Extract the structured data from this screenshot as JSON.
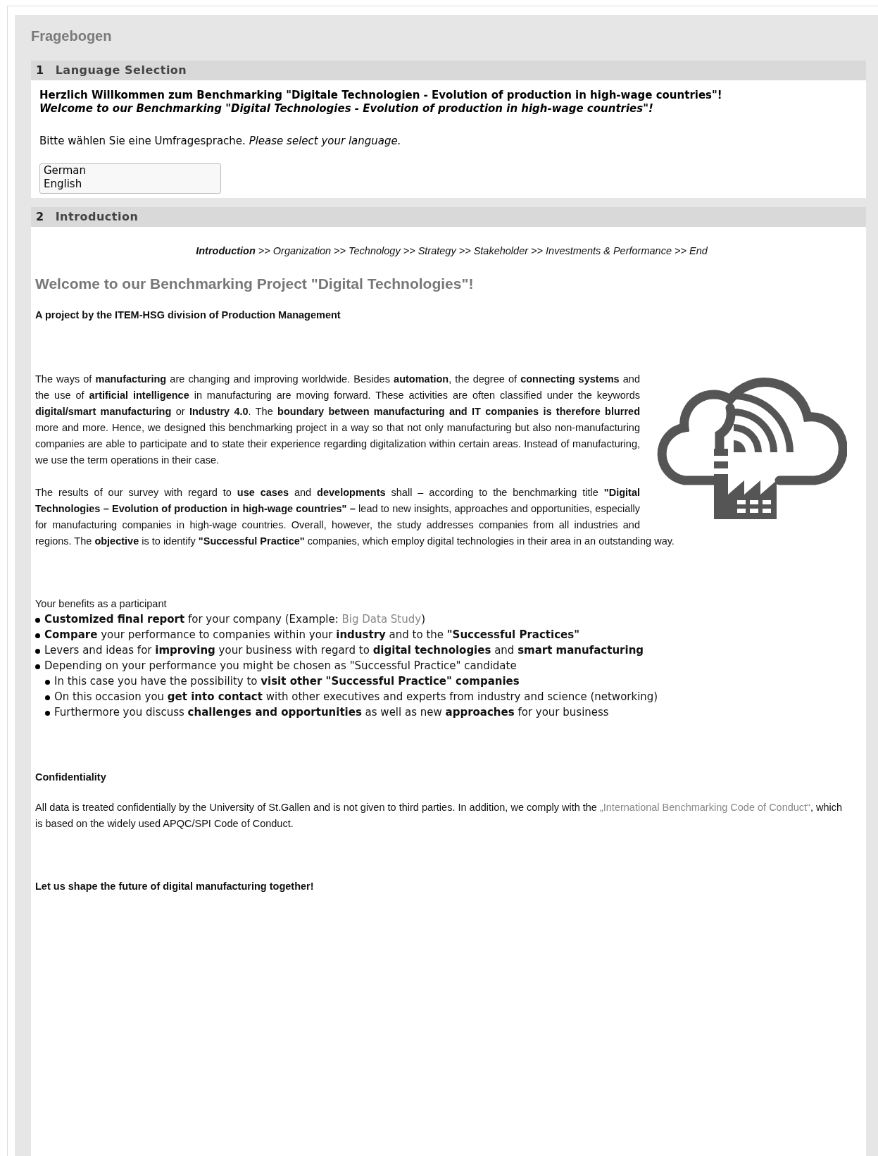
{
  "page_title": "Fragebogen",
  "sections": [
    {
      "number": "1",
      "title": "Language Selection"
    },
    {
      "number": "2",
      "title": "Introduction"
    }
  ],
  "language": {
    "welcome_de": "Herzlich Willkommen zum Benchmarking \"Digitale Technologien - Evolution of production in high-wage countries\"!",
    "welcome_en": "Welcome to our Benchmarking \"Digital Technologies - Evolution of production in high-wage countries\"!",
    "prompt": "Bitte wählen Sie eine Umfragesprache. *Please select your language.*",
    "options": [
      {
        "label": "German",
        "selected": false
      },
      {
        "label": "English",
        "selected": false
      }
    ]
  },
  "intro": {
    "breadcrumb": [
      {
        "label": "Introduction",
        "selected": true
      },
      {
        "label": "Organization",
        "selected": false
      },
      {
        "label": "Technology",
        "selected": false
      },
      {
        "label": "Strategy",
        "selected": false
      },
      {
        "label": "Stakeholder",
        "selected": false
      },
      {
        "label": "Investments & Performance",
        "selected": false
      },
      {
        "label": "End",
        "selected": false
      }
    ],
    "separator": ">>",
    "heading": "Welcome to our Benchmarking Project \"Digital Technologies\"!",
    "byline": "A project by the ITEM-HSG division of Production Management",
    "paragraphs": [
      "The ways of **manufacturing** are changing and improving worldwide. Besides **automation**, the degree of **connecting systems** and the use of **artificial intelligence** in manufacturing are moving forward. These activities are often classified under the keywords **digital/smart manufacturing** or **Industry 4.0**. The **boundary between manufacturing and IT companies is therefore blurred** more and more. Hence, we designed this benchmarking project in a way so that not only manufacturing but also non-manufacturing companies are able to participate and to state their experience regarding digitalization within certain areas. Instead of manufacturing, we use the term operations in their case.",
      "The results of our survey with regard to **use cases** and **developments** shall – according to the benchmarking title **\"Digital Technologies – Evolution of production in high-wage countries\" –** lead to new insights, approaches and opportunities, especially for manufacturing companies in high-wage countries. Overall, however, the study addresses companies from all industries and regions. The **objective** is to identify **\"Successful Practice\"** companies, which employ digital technologies in their area in an outstanding way."
    ],
    "benefits_title": "Your benefits as a participant",
    "benefits": [
      {
        "text": "**Customized final report** for your company (Example: ",
        "link": "Big Data Study",
        "after": ")"
      },
      {
        "text": "**Compare** your performance to companies within your **industry** and to the **\"Successful Practices\"**"
      },
      {
        "text": "Levers and ideas for **improving** your business with regard to **digital technologies** and **smart manufacturing**"
      },
      {
        "text": "Depending on your performance you might be chosen as \"Successful Practice\" candidate",
        "children": [
          {
            "text": "In this case you have the possibility to **visit other \"Successful Practice\" companies**"
          },
          {
            "text": "On this occasion you **get into contact** with other executives and experts from industry and science (networking)"
          },
          {
            "text": "Furthermore you discuss **challenges and opportunities** as well as new **approaches** for your business"
          }
        ]
      }
    ],
    "confidentiality_title": "Confidentiality",
    "confidentiality": {
      "text": "All data is treated confidentially by the University of St.Gallen and is not given to third parties. In addition, we comply with the ",
      "link": "„International Benchmarking Code of Conduct“",
      "after": ", which is based on the widely used APQC/SPI Code of Conduct."
    },
    "closing": "Let us shape the future of digital manufacturing together!"
  }
}
